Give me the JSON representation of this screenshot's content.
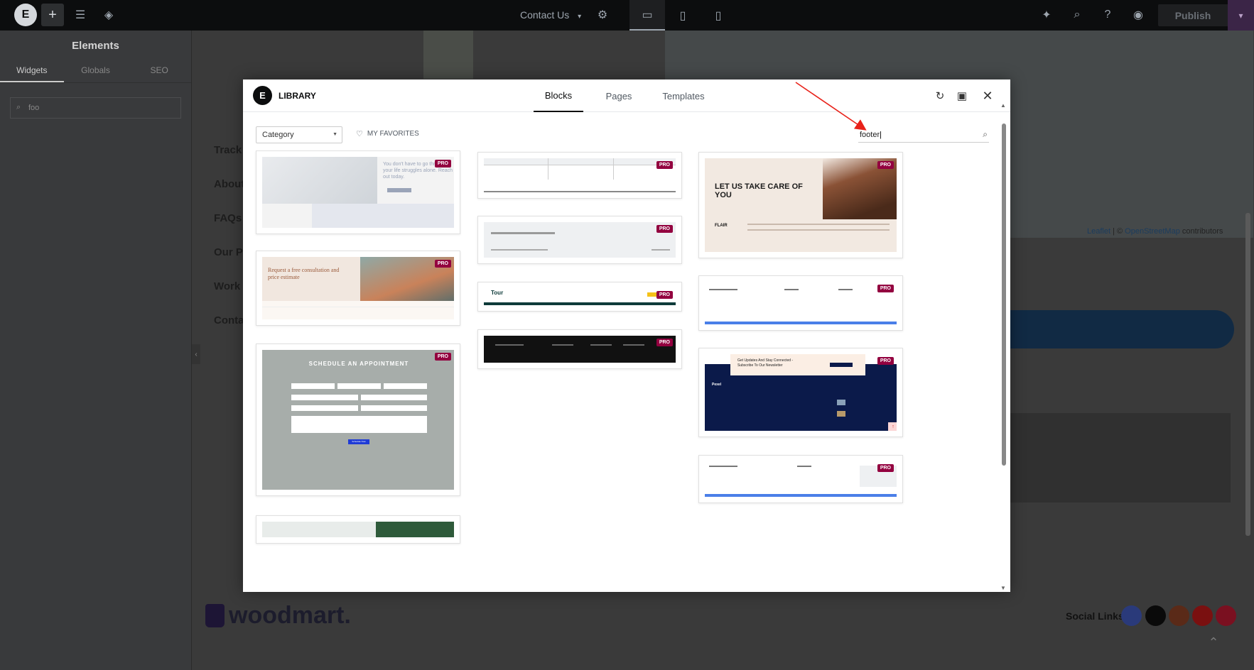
{
  "topbar": {
    "page_title": "Contact Us",
    "publish_label": "Publish"
  },
  "panel": {
    "title": "Elements",
    "tabs": [
      "Widgets",
      "Globals",
      "SEO"
    ],
    "search_value": "foo"
  },
  "canvas": {
    "nav_items": [
      "Track",
      "About",
      "FAQs",
      "Our P",
      "Work",
      "Conta"
    ],
    "map_credit_leaflet": "Leaflet",
    "map_credit_sep": " | © ",
    "map_credit_osm": "OpenStreetMap",
    "map_credit_tail": " contributors",
    "brand": "woodmart.",
    "social_label": "Social Links"
  },
  "library": {
    "title": "LIBRARY",
    "tabs": [
      "Blocks",
      "Pages",
      "Templates"
    ],
    "active_tab": "Blocks",
    "category_label": "Category",
    "favorites_label": "MY FAVORITES",
    "search_value": "footer",
    "pro_badge": "PRO",
    "thumb_texts": {
      "c1_headline": "You don't have to go through your life struggles alone. Reach out today.",
      "c2_headline": "Request a free consultation and price estimate",
      "c3_headline": "SCHEDULE AN APPOINTMENT",
      "c3_button": "Schedule Now",
      "c8_headline": "LET US TAKE CARE OF YOU",
      "c8_brand": "FLAIR",
      "c10_headline": "Get Updates And Stay Connected - Subscribe To Our Newsletter",
      "c10_brand": "Pexel",
      "c6_brand": "Tour"
    }
  },
  "colors": {
    "topbar_bg": "#0c0d0e",
    "pro_badge": "#93003f",
    "accent_blue": "#4a7fe8",
    "arrow_red": "#e8221a"
  }
}
